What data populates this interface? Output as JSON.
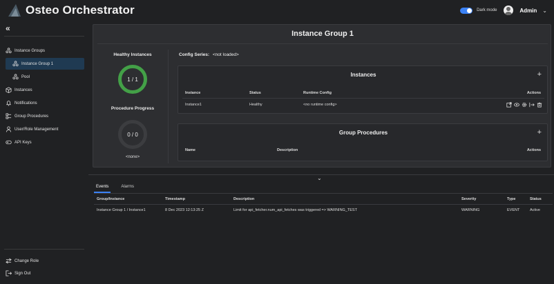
{
  "header": {
    "title": "Osteo Orchestrator",
    "dark_mode_label": "Dark mode",
    "dark_mode_on": true,
    "user": "Admin"
  },
  "sidebar": {
    "collapse_glyph": "«",
    "items": [
      {
        "label": "Instance Groups",
        "icon": "groups-icon"
      },
      {
        "label": "Instance Group 1",
        "icon": "groups-icon",
        "active": true
      },
      {
        "label": "Pool",
        "icon": "groups-icon"
      },
      {
        "label": "Instances",
        "icon": "cube-icon"
      },
      {
        "label": "Notifications",
        "icon": "bell-icon"
      },
      {
        "label": "Group Procedures",
        "icon": "procedure-icon"
      },
      {
        "label": "User/Role Management",
        "icon": "user-icon"
      },
      {
        "label": "API Keys",
        "icon": "key-icon"
      }
    ],
    "bottom": [
      {
        "label": "Change Role",
        "icon": "swap-icon"
      },
      {
        "label": "Sign Out",
        "icon": "signout-icon"
      }
    ]
  },
  "main": {
    "title": "Instance Group 1",
    "healthy_title": "Healthy Instances",
    "healthy_value": "1 / 1",
    "progress_title": "Procedure Progress",
    "progress_value": "0 / 0",
    "progress_caption": "<none>",
    "config_label": "Config Series:",
    "config_value": "<not loaded>",
    "instances": {
      "title": "Instances",
      "add": "+",
      "columns": [
        "Instance",
        "Status",
        "Runtime Config",
        "Actions"
      ],
      "rows": [
        {
          "instance": "Instance1",
          "status": "Healthy",
          "runtime_config": "<no runtime config>"
        }
      ]
    },
    "procedures": {
      "title": "Group Procedures",
      "add": "+",
      "columns": [
        "Name",
        "Description",
        "Actions"
      ]
    }
  },
  "events": {
    "tabs": [
      "Events",
      "Alarms"
    ],
    "columns": [
      "Group/Instance",
      "Timestamp",
      "Description",
      "Severity",
      "Type",
      "Status"
    ],
    "rows": [
      {
        "group_instance": "Instance Group 1 / Instance1",
        "timestamp": "8 Dec 2023 12:13:25 Z",
        "description": "Limit for api_fetcher.num_api_fetches was triggered => WARNING_TEST",
        "severity": "WARNING",
        "type": "EVENT",
        "status": "Active"
      }
    ]
  },
  "colors": {
    "accent": "#3b82f6",
    "healthy": "#43a047",
    "active_nav": "#1f3a52"
  }
}
